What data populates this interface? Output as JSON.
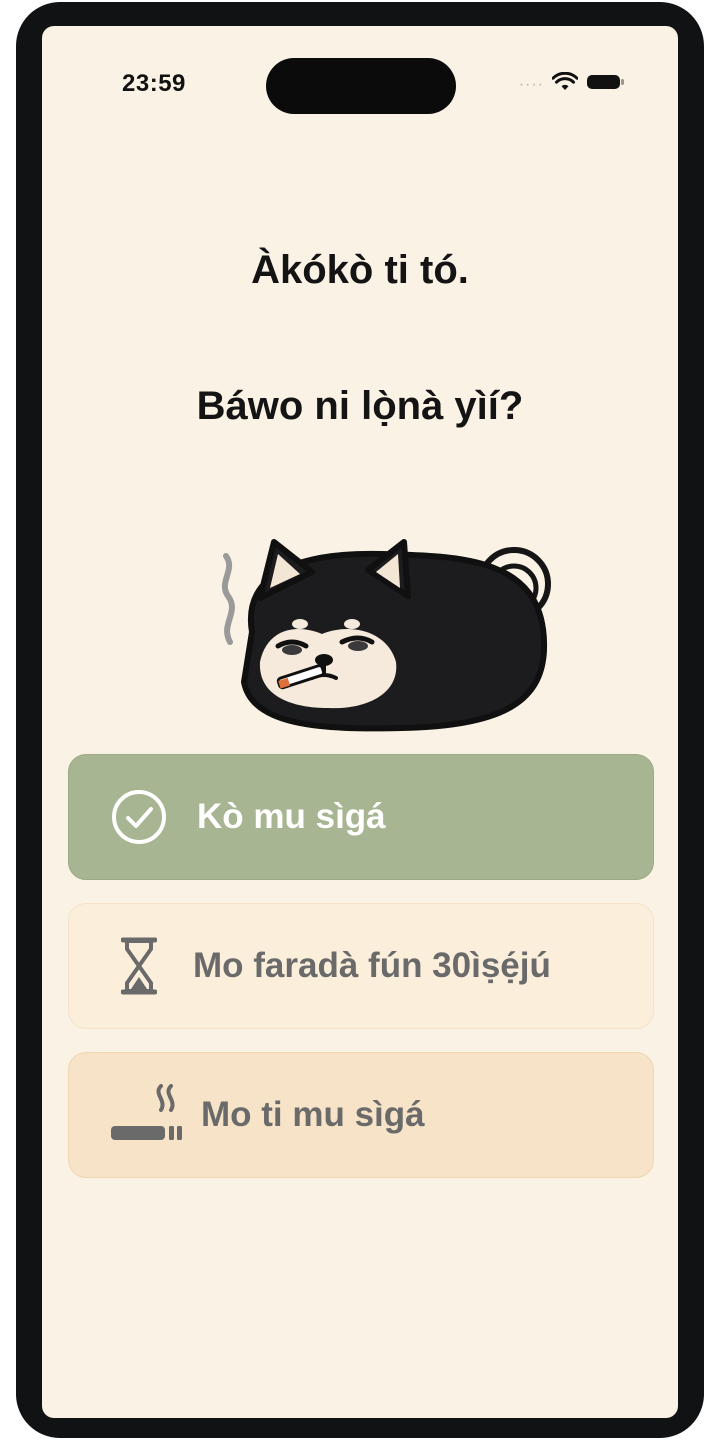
{
  "status_bar": {
    "time": "23:59",
    "signal_icon": "cellular-dots-icon",
    "wifi_icon": "wifi-icon",
    "battery_icon": "battery-icon"
  },
  "screen": {
    "heading_1": "Àkókò ti tó.",
    "heading_2": "Báwo ni lọ̀nà yìí?",
    "illustration": "smoking-shiba-dog-illustration"
  },
  "options": [
    {
      "label": "Kò mu sìgá",
      "icon": "check-circle-icon"
    },
    {
      "label": "Mo faradà fún 30ìṣẹ́jú",
      "icon": "hourglass-icon"
    },
    {
      "label": "Mo ti mu sìgá",
      "icon": "cigarette-smoke-icon"
    }
  ],
  "colors": {
    "background": "#faf2e5",
    "option_success": "#a7b593",
    "option_wait": "#fbeedb",
    "option_smoked": "#f7e3c7",
    "text_primary": "#141414",
    "text_muted": "#6a6a6a"
  }
}
